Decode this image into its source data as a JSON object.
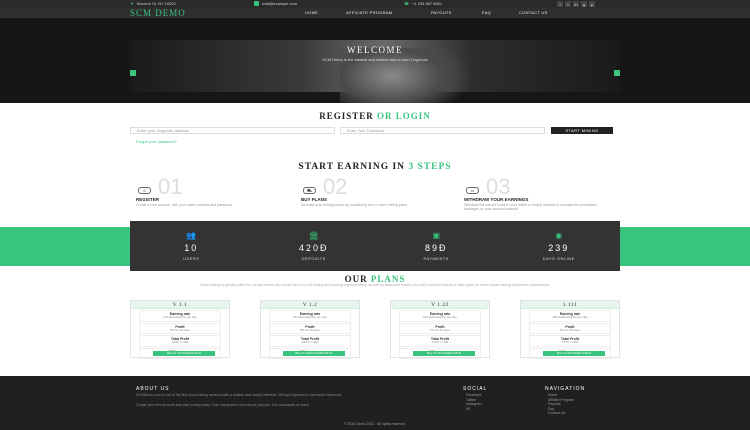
{
  "topbar": {
    "address": "Broome St, NY 10002",
    "email": "mail@example.com",
    "phone": "+1 234 567 8901",
    "social": [
      "f",
      "t",
      "in",
      "g",
      "p"
    ]
  },
  "nav": {
    "logo": "SCM DEMO",
    "items": [
      "HOME",
      "AFFILIATE PROGRAM",
      "PAYOUTS",
      "FAQ",
      "CONTACT US"
    ]
  },
  "hero": {
    "title": "WELCOME",
    "subtitle": "SCM Demo is the easiest and fastest way to earn Dogecoin",
    "prev": "‹",
    "next": "›"
  },
  "register": {
    "title_a": "REGISTER",
    "title_b": "OR LOGIN",
    "address_placeholder": "Enter your Dogecoin address",
    "password_placeholder": "Enter Your Password",
    "button": "START MINING",
    "forgot": "Forgot your password?"
  },
  "steps": {
    "title_a": "START EARNING IN",
    "title_b": "3 STEPS",
    "items": [
      {
        "num": "01",
        "title": "REGISTER",
        "text": "Create a new account, with your wallet address and password"
      },
      {
        "num": "02",
        "title": "BUY PLANS",
        "text": "Increase your mining power by purchasing one or more mining plans"
      },
      {
        "num": "03",
        "title": "WITHDRAW YOUR EARNINGS",
        "text": "Withdraw the earned coins to your wallet or simply reinvest to increase the purchased packages on your account balance"
      }
    ]
  },
  "stats": [
    {
      "value": "10",
      "label": "USERS"
    },
    {
      "value": "420Đ",
      "label": "DEPOSITS"
    },
    {
      "value": "89Đ",
      "label": "PAYMENTS"
    },
    {
      "value": "239",
      "label": "DAYS ONLINE"
    }
  ],
  "plans": {
    "title_a": "OUR",
    "title_b": "PLANS",
    "desc": "Cloud mining is greatly suited for normal miners who would like to try out mining and earning cryptocurrency, as well as seasoned miners who don't want the hassle or risks spent on home-based mining equipment maintenance.",
    "items": [
      {
        "name": "V 1.1",
        "rate": "10 Hashrate(H/s) per day",
        "profit": "5% for 30 days",
        "total": "150% in 30d",
        "aff": "3%",
        "btn": "Buy for 10 DOGECOIN Đ"
      },
      {
        "name": "V 1.2",
        "rate": "50 Hashrate(H/s) per day",
        "profit": "8% for 30 days",
        "total": "240% in 30d",
        "aff": "4%",
        "btn": "Buy for 1000 DOGECOIN Đ"
      },
      {
        "name": "V 1.22",
        "rate": "80 Hashrate(H/s) per day",
        "profit": "7% for 30 days",
        "total": "210% in 30d",
        "aff": "5%",
        "btn": "Buy for 25 DOGECOIN Đ"
      },
      {
        "name": "1.111",
        "rate": "100 Hashrate(H/s) per day",
        "profit": "9% for 30 days",
        "total": "270% in 30d",
        "aff": "6%",
        "btn": "Buy for 50 DOGECOIN Đ"
      }
    ],
    "labels": {
      "rate": "Earning rate",
      "profit": "Profit",
      "total": "Total Profit",
      "aff": "Affiliate bonus"
    }
  },
  "footer": {
    "about_title": "ABOUT US",
    "about_text_1": "SCMDemo.com is one of the first cloud mining services with a reliable and simple interface. Mining Dogecoin is now easier than ever.",
    "about_text_2": "Create your free account and start mining today. Fast, transparent and secure payouts. Join thousands of users.",
    "social_title": "SOCIAL",
    "social_items": [
      "Facebook",
      "Twitter",
      "Instagram",
      "VK"
    ],
    "nav_title": "NAVIGATION",
    "nav_items": [
      "Home",
      "Affiliate Program",
      "Payouts",
      "Faq",
      "Contact Us"
    ],
    "copyright": "© SCM Demo 2021 . All rights reserved."
  }
}
